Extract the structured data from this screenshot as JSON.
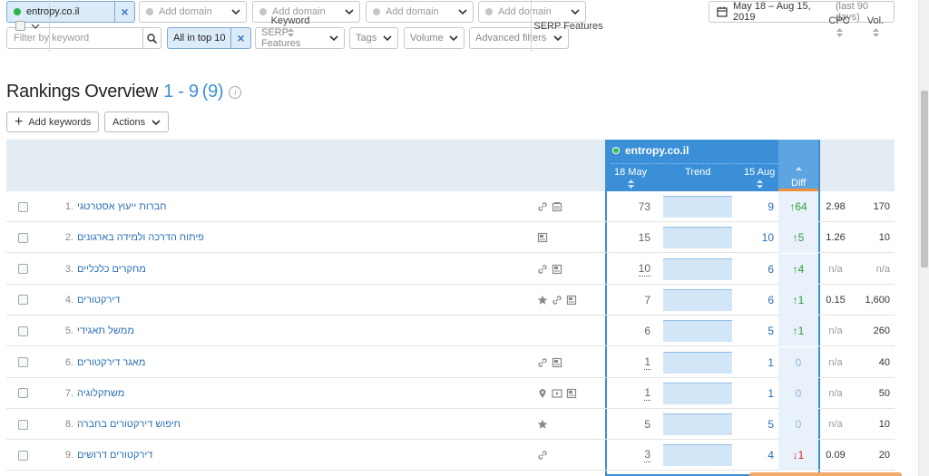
{
  "domains": {
    "primary": "entropy.co.il",
    "slots": [
      "Add domain",
      "Add domain",
      "Add domain",
      "Add domain"
    ]
  },
  "date_range": {
    "label": "May 18 – Aug 15, 2019",
    "suffix": "(last 90 days)"
  },
  "filters": {
    "keyword_placeholder": "Filter by keyword",
    "active_filter": "All in top 10",
    "buttons": [
      "SERP Features",
      "Tags",
      "Volume",
      "Advanced filters"
    ]
  },
  "heading": {
    "title": "Rankings Overview",
    "range": "1 - 9",
    "count": "(9)"
  },
  "actions": {
    "add_keywords": "Add keywords",
    "actions": "Actions"
  },
  "table": {
    "columns": {
      "keyword": "Keyword",
      "serp": "SERP Features",
      "domain": "entropy.co.il",
      "first_date": "18 May",
      "trend": "Trend",
      "last_date": "15 Aug",
      "diff": "Diff",
      "cpc": "CPC",
      "vol": "Vol."
    },
    "rows": [
      {
        "num": "1.",
        "keyword": "חברות ייעוץ אסטרטגי",
        "serp": [
          "link-icon",
          "image-icon"
        ],
        "first": "73",
        "last": "9",
        "diff": "↑64",
        "dir": "up",
        "cpc": "2.98",
        "vol": "170",
        "underline": false
      },
      {
        "num": "2.",
        "keyword": "פיתוח הדרכה ולמידה בארגונים",
        "serp": [
          "reviews-icon"
        ],
        "first": "15",
        "last": "10",
        "diff": "↑5",
        "dir": "up",
        "cpc": "1.26",
        "vol": "10",
        "underline": false
      },
      {
        "num": "3.",
        "keyword": "מחקרים כלכליים",
        "serp": [
          "link-icon",
          "reviews-icon"
        ],
        "first": "10",
        "last": "6",
        "diff": "↑4",
        "dir": "up",
        "cpc": "n/a",
        "vol": "n/a",
        "underline": true
      },
      {
        "num": "4.",
        "keyword": "דירקטורים",
        "serp": [
          "star-icon",
          "link-icon",
          "reviews-icon"
        ],
        "first": "7",
        "last": "6",
        "diff": "↑1",
        "dir": "up",
        "cpc": "0.15",
        "vol": "1,600",
        "underline": false
      },
      {
        "num": "5.",
        "keyword": "ממשל תאגידי",
        "serp": [],
        "first": "6",
        "last": "5",
        "diff": "↑1",
        "dir": "up",
        "cpc": "n/a",
        "vol": "260",
        "underline": false
      },
      {
        "num": "6.",
        "keyword": "מאגר דירקטורים",
        "serp": [
          "link-icon",
          "reviews-icon"
        ],
        "first": "1",
        "last": "1",
        "diff": "0",
        "dir": "zero",
        "cpc": "n/a",
        "vol": "40",
        "underline": true
      },
      {
        "num": "7.",
        "keyword": "משתקלוגיה",
        "serp": [
          "pin-icon",
          "video-icon",
          "reviews-icon"
        ],
        "first": "1",
        "last": "1",
        "diff": "0",
        "dir": "zero",
        "cpc": "n/a",
        "vol": "50",
        "underline": true
      },
      {
        "num": "8.",
        "keyword": "חיפוש דירקטורים בחברה",
        "serp": [
          "star-icon"
        ],
        "first": "5",
        "last": "5",
        "diff": "0",
        "dir": "zero",
        "cpc": "n/a",
        "vol": "10",
        "underline": false
      },
      {
        "num": "9.",
        "keyword": "דירקטורים דרושים",
        "serp": [
          "link-icon"
        ],
        "first": "3",
        "last": "4",
        "diff": "↓1",
        "dir": "down",
        "cpc": "0.09",
        "vol": "20",
        "underline": true
      }
    ]
  }
}
